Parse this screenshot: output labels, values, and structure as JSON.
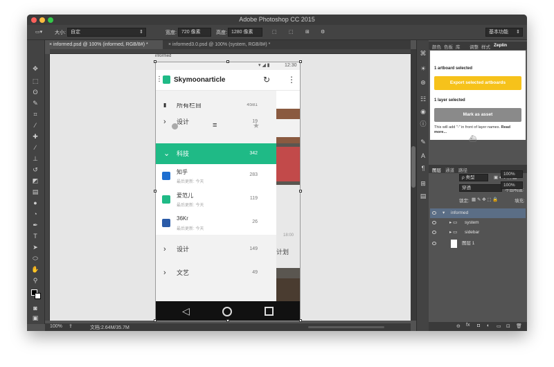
{
  "window": {
    "title": "Adobe Photoshop CC 2015"
  },
  "options_bar": {
    "size_label": "大小:",
    "size_value": "自定",
    "width_label": "宽度:",
    "width_value": "720 像素",
    "height_label": "高度:",
    "height_value": "1280 像素",
    "workspace_value": "基本功能"
  },
  "doc_tabs": [
    {
      "label": "informed.psd @ 100% (informed, RGB/8#) *"
    },
    {
      "label": "informed3.0.psd @ 100% (system, RGB/8#) *"
    }
  ],
  "artboard_label": "informed",
  "status": {
    "zoom": "100%",
    "doc": "文档:2.64M/35.7M"
  },
  "panel_tabs": [
    "颜色",
    "色板",
    "库",
    "调整",
    "样式",
    "Zeplin"
  ],
  "zeplin": {
    "artboard_count": "1 artboard selected",
    "export_button": "Export selected artboards",
    "layer_count": "1 layer selected",
    "mark_button": "Mark as asset",
    "note_prefix": "This will add \"-\" in front of layer names.",
    "note_link": "Read more..."
  },
  "layers_panel": {
    "tabs": [
      "图层",
      "通道",
      "路径"
    ],
    "filter_value": "ρ 类型",
    "blend_value": "穿透",
    "opacity_label": "不透明度:",
    "opacity_value": "100%",
    "lock_label": "锁定:",
    "fill_label": "填充:",
    "fill_value": "100%",
    "layers": [
      {
        "name": "informed"
      },
      {
        "name": "system"
      },
      {
        "name": "sidebar"
      },
      {
        "name": "图层 1"
      }
    ]
  },
  "phone": {
    "time": "12:30",
    "app_title": "Skymoonarticle",
    "top_partial_label": "所有栏目",
    "top_partial_count": "4581",
    "sections": [
      {
        "label": "设计",
        "count": "19"
      },
      {
        "label": "科技",
        "count": "342"
      }
    ],
    "sources": [
      {
        "name": "知乎",
        "updated": "最后更新: 今天",
        "count": "283"
      },
      {
        "name": "爱范儿",
        "updated": "最后更新: 今天",
        "count": "119"
      },
      {
        "name": "36Kr",
        "updated": "最后更新: 今天",
        "count": "26"
      }
    ],
    "bottom_sections": [
      {
        "label": "设计",
        "count": "149"
      },
      {
        "label": "文艺",
        "count": "49"
      }
    ],
    "bg_text": "计划",
    "bg_time": "18:00",
    "colors": {
      "accent": "#1fba86"
    }
  },
  "colors": {
    "zeplin_yellow": "#f6c21b",
    "selected_layer": "#5b6e86"
  }
}
